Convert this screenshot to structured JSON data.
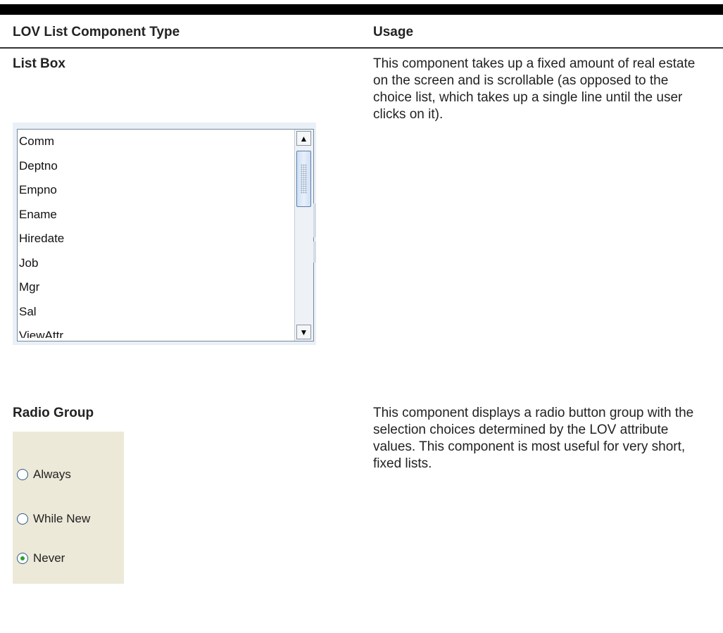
{
  "table": {
    "headers": [
      "LOV List Component Type",
      "Usage"
    ],
    "rows": [
      {
        "type": "List Box",
        "usage": "This component takes up a fixed amount of real estate on the screen and is scrollable (as opposed to the choice list, which takes up a single line until the user clicks on it)."
      },
      {
        "type": "Radio Group",
        "usage": "This component displays a radio button group with the selection choices determined by the LOV attribute values. This component is most useful for very short, fixed lists."
      }
    ]
  },
  "listbox": {
    "items": [
      "Comm",
      "Deptno",
      "Empno",
      "Ename",
      "Hiredate",
      "Job",
      "Mgr",
      "Sal",
      "ViewAttr"
    ]
  },
  "radiogroup": {
    "options": [
      "Always",
      "While New",
      "Never"
    ],
    "selected": "Never"
  }
}
